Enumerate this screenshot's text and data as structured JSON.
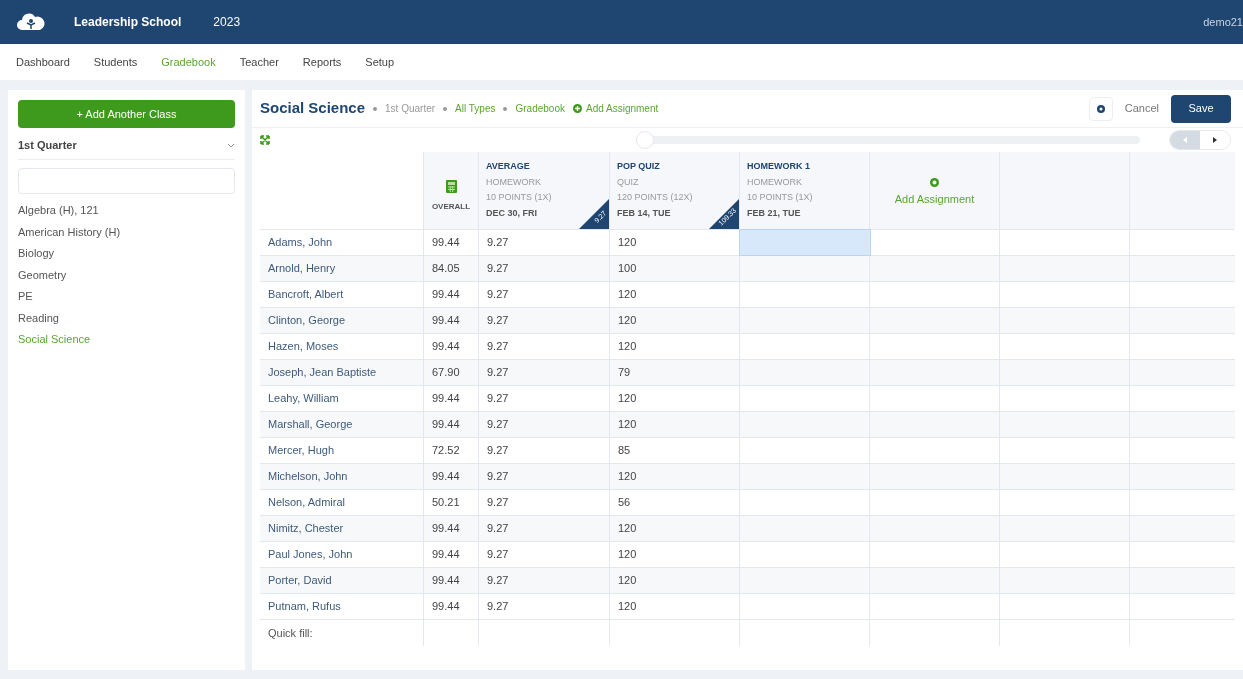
{
  "app_bar": {
    "school": "Leadership School",
    "year": "2023",
    "user": "demo21"
  },
  "nav": [
    {
      "label": "Dashboard",
      "selected": false
    },
    {
      "label": "Students",
      "selected": false
    },
    {
      "label": "Gradebook",
      "selected": true
    },
    {
      "label": "Teacher",
      "selected": false
    },
    {
      "label": "Reports",
      "selected": false
    },
    {
      "label": "Setup",
      "selected": false
    }
  ],
  "sidebar": {
    "add_button": "+ Add Another Class",
    "term": "1st Quarter",
    "classes": [
      {
        "label": "Algebra (H), 121",
        "selected": false
      },
      {
        "label": "American History (H)",
        "selected": false
      },
      {
        "label": "Biology",
        "selected": false
      },
      {
        "label": "Geometry",
        "selected": false
      },
      {
        "label": "PE",
        "selected": false
      },
      {
        "label": "Reading",
        "selected": false
      },
      {
        "label": "Social Science",
        "selected": true
      }
    ]
  },
  "toolbar": {
    "title": "Social Science",
    "breadcrumbs": [
      {
        "label": "1st Quarter",
        "kind": "plain"
      },
      {
        "label": "All Types",
        "kind": "link"
      },
      {
        "label": "Gradebook",
        "kind": "link"
      }
    ],
    "add_assignment": "Add Assignment",
    "cancel": "Cancel",
    "save": "Save"
  },
  "table": {
    "overall": "OVERALL",
    "assignments": [
      {
        "name": "AVERAGE",
        "type": "HOMEWORK",
        "points": "10 POINTS (1X)",
        "date": "DEC 30, FRI",
        "corner": "9.27"
      },
      {
        "name": "POP QUIZ",
        "type": "QUIZ",
        "points": "120 POINTS (12X)",
        "date": "FEB 14, TUE",
        "corner": "109.33"
      },
      {
        "name": "HOMEWORK 1",
        "type": "HOMEWORK",
        "points": "10 POINTS (1X)",
        "date": "FEB 21, TUE"
      }
    ],
    "add_column": "Add Assignment",
    "rows": [
      {
        "name": "Adams, John",
        "overall": "99.44",
        "average": "9.27",
        "pop_quiz": "120",
        "selected": true
      },
      {
        "name": "Arnold, Henry",
        "overall": "84.05",
        "average": "9.27",
        "pop_quiz": "100",
        "selected": false
      },
      {
        "name": "Bancroft, Albert",
        "overall": "99.44",
        "average": "9.27",
        "pop_quiz": "120",
        "selected": false
      },
      {
        "name": "Clinton, George",
        "overall": "99.44",
        "average": "9.27",
        "pop_quiz": "120",
        "selected": false
      },
      {
        "name": "Hazen, Moses",
        "overall": "99.44",
        "average": "9.27",
        "pop_quiz": "120",
        "selected": false
      },
      {
        "name": "Joseph, Jean Baptiste",
        "overall": "67.90",
        "average": "9.27",
        "pop_quiz": "79",
        "selected": false
      },
      {
        "name": "Leahy, William",
        "overall": "99.44",
        "average": "9.27",
        "pop_quiz": "120",
        "selected": false
      },
      {
        "name": "Marshall, George",
        "overall": "99.44",
        "average": "9.27",
        "pop_quiz": "120",
        "selected": false
      },
      {
        "name": "Mercer, Hugh",
        "overall": "72.52",
        "average": "9.27",
        "pop_quiz": "85",
        "selected": false
      },
      {
        "name": "Michelson, John",
        "overall": "99.44",
        "average": "9.27",
        "pop_quiz": "120",
        "selected": false
      },
      {
        "name": "Nelson, Admiral",
        "overall": "50.21",
        "average": "9.27",
        "pop_quiz": "56",
        "selected": false
      },
      {
        "name": "Nimitz, Chester",
        "overall": "99.44",
        "average": "9.27",
        "pop_quiz": "120",
        "selected": false
      },
      {
        "name": "Paul Jones, John",
        "overall": "99.44",
        "average": "9.27",
        "pop_quiz": "120",
        "selected": false
      },
      {
        "name": "Porter, David",
        "overall": "99.44",
        "average": "9.27",
        "pop_quiz": "120",
        "selected": false
      },
      {
        "name": "Putnam, Rufus",
        "overall": "99.44",
        "average": "9.27",
        "pop_quiz": "120",
        "selected": false
      }
    ],
    "quick_fill": "Quick fill:"
  }
}
